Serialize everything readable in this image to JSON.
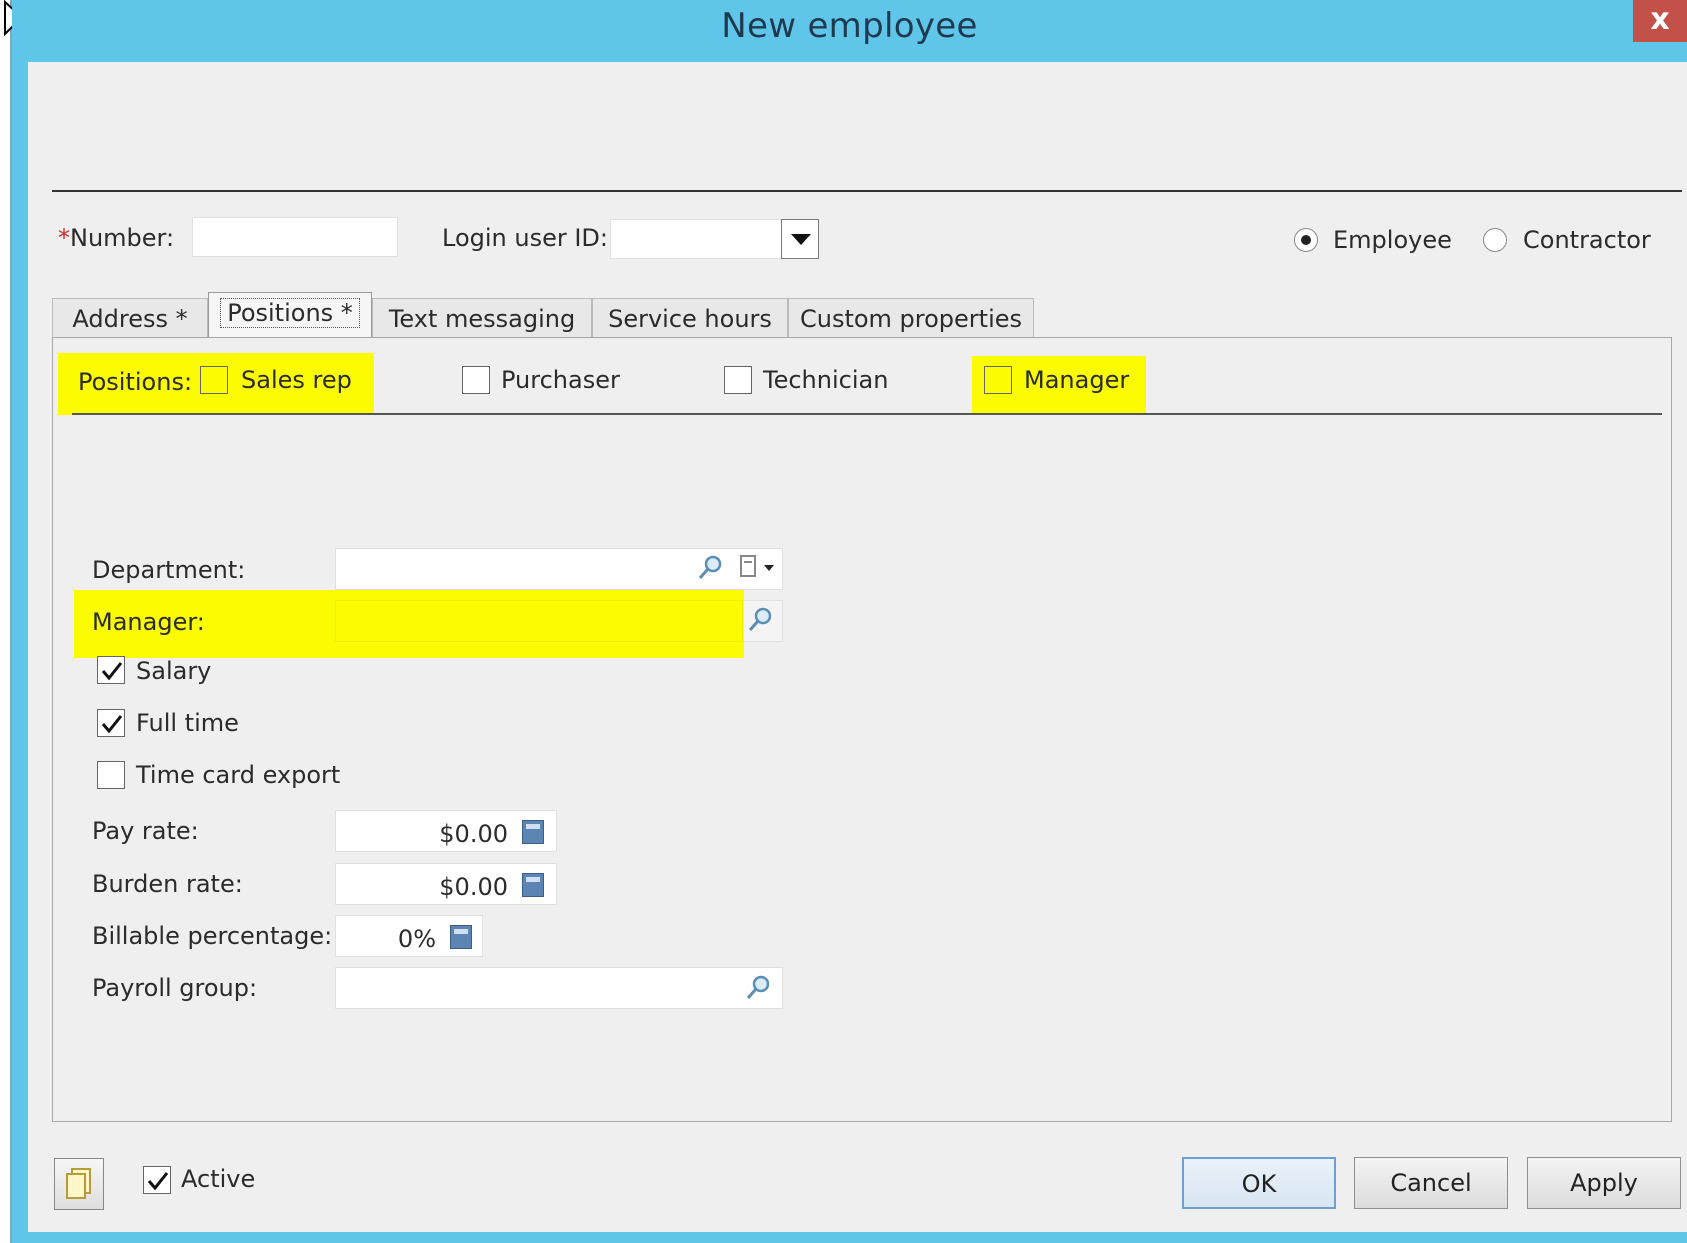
{
  "window": {
    "title": "New employee",
    "close_glyph": "x"
  },
  "header": {
    "number_label": "Number:",
    "number_required_mark": "*",
    "number_value": "",
    "login_label": "Login user ID:",
    "login_value": "",
    "employee_type": {
      "options": [
        "Employee",
        "Contractor"
      ],
      "selected": "Employee"
    }
  },
  "tabs": [
    {
      "label": "Address *",
      "active": false
    },
    {
      "label": "Positions *",
      "active": true
    },
    {
      "label": "Text messaging",
      "active": false
    },
    {
      "label": "Service hours",
      "active": false
    },
    {
      "label": "Custom properties",
      "active": false
    }
  ],
  "positions": {
    "label": "Positions:",
    "items": [
      {
        "label": "Sales rep",
        "checked": false,
        "highlighted": true
      },
      {
        "label": "Purchaser",
        "checked": false,
        "highlighted": false
      },
      {
        "label": "Technician",
        "checked": false,
        "highlighted": false
      },
      {
        "label": "Manager",
        "checked": false,
        "highlighted": true
      }
    ]
  },
  "form": {
    "department_label": "Department:",
    "department_value": "",
    "manager_label": "Manager:",
    "manager_value": "",
    "salary_label": "Salary",
    "salary_checked": true,
    "fulltime_label": "Full time",
    "fulltime_checked": true,
    "timecard_label": "Time card export",
    "timecard_checked": false,
    "payrate_label": "Pay rate:",
    "payrate_value": "$0.00",
    "burden_label": "Burden rate:",
    "burden_value": "$0.00",
    "billable_label": "Billable percentage:",
    "billable_value": "0%",
    "payroll_label": "Payroll group:",
    "payroll_value": ""
  },
  "footer": {
    "active_label": "Active",
    "active_checked": true,
    "ok_label": "OK",
    "cancel_label": "Cancel",
    "apply_label": "Apply"
  },
  "colors": {
    "titlebar": "#5fc6ea",
    "highlight": "#fbfb02",
    "close": "#c4504a"
  },
  "icons": [
    "cursor-arrow-icon",
    "close-icon",
    "chevron-down-icon",
    "search-icon",
    "dropdown-menu-icon",
    "calculator-icon",
    "notes-icon",
    "checkmark-icon"
  ]
}
